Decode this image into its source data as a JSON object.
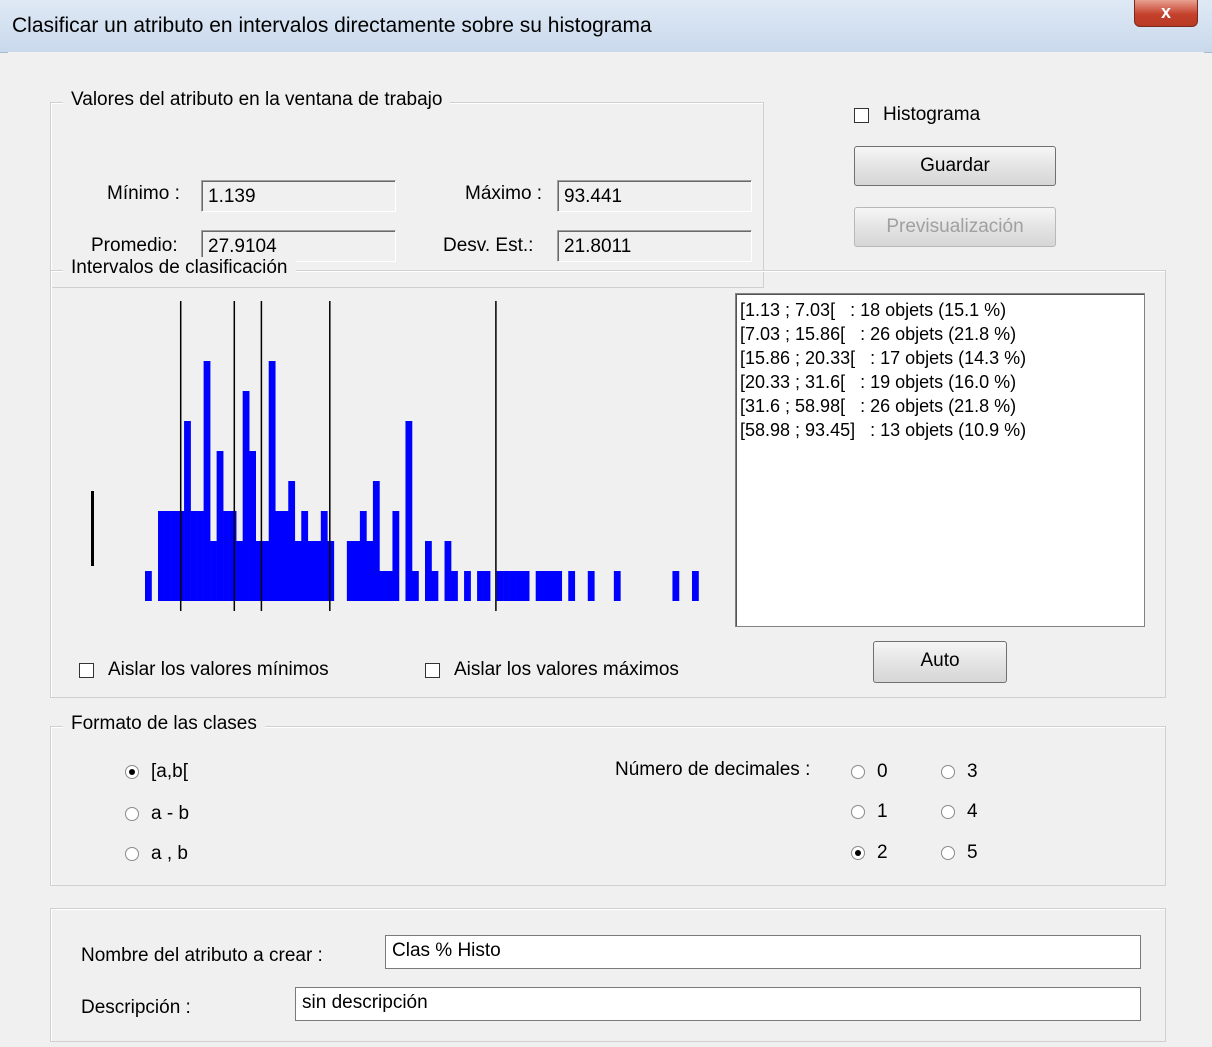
{
  "window": {
    "title": "Clasificar un atributo en intervalos directamente sobre su histograma",
    "close_label": "x"
  },
  "values_group": {
    "legend": "Valores del atributo en la ventana de trabajo",
    "min_label": "Mínimo :",
    "min_value": "1.139",
    "max_label": "Máximo :",
    "max_value": "93.441",
    "avg_label": "Promedio:",
    "avg_value": "27.9104",
    "std_label": "Desv. Est.:",
    "std_value": "21.8011"
  },
  "actions": {
    "histogram_label": "Histograma",
    "histogram_checked": false,
    "save_label": "Guardar",
    "preview_label": "Previsualización"
  },
  "intervals_group": {
    "legend": "Intervalos de clasificación",
    "list": [
      "[1.13 ; 7.03[   : 18 objets (15.1 %)",
      "[7.03 ; 15.86[   : 26 objets (21.8 %)",
      "[15.86 ; 20.33[   : 17 objets (14.3 %)",
      "[20.33 ; 31.6[   : 19 objets (16.0 %)",
      "[31.6 ; 58.98[   : 26 objets (21.8 %)",
      "[58.98 ; 93.45]   : 13 objets (10.9 %)"
    ],
    "isolate_min_label": "Aislar los valores mínimos",
    "isolate_max_label": "Aislar los valores máximos",
    "auto_label": "Auto",
    "bar_color": "#0000ff"
  },
  "chart_data": {
    "type": "bar",
    "x_range": [
      1.139,
      93.441
    ],
    "values": [
      1,
      0,
      3,
      3,
      3,
      3,
      6,
      3,
      3,
      8,
      2,
      5,
      3,
      3,
      2,
      7,
      5,
      2,
      2,
      8,
      3,
      3,
      4,
      2,
      3,
      2,
      2,
      3,
      2,
      0,
      0,
      2,
      2,
      3,
      2,
      4,
      1,
      1,
      3,
      0,
      6,
      1,
      0,
      2,
      1,
      0,
      2,
      1,
      0,
      1,
      0,
      1,
      1,
      0,
      1,
      1,
      1,
      1,
      1,
      0,
      1,
      1,
      1,
      1,
      0,
      1,
      0,
      0,
      1,
      0,
      0,
      0,
      1,
      0,
      0,
      0,
      0,
      0,
      0,
      0,
      0,
      1,
      0,
      0,
      1,
      0
    ],
    "breaks": [
      7.03,
      15.86,
      20.33,
      31.6,
      58.98
    ]
  },
  "format_group": {
    "legend": "Formato de las clases",
    "formats": [
      {
        "label": "[a,b[",
        "checked": true
      },
      {
        "label": "a - b",
        "checked": false
      },
      {
        "label": "a , b",
        "checked": false
      }
    ],
    "decimals_label": "Número de decimales :",
    "decimals": [
      {
        "label": "0",
        "checked": false
      },
      {
        "label": "1",
        "checked": false
      },
      {
        "label": "2",
        "checked": true
      },
      {
        "label": "3",
        "checked": false
      },
      {
        "label": "4",
        "checked": false
      },
      {
        "label": "5",
        "checked": false
      }
    ]
  },
  "name_group": {
    "name_label": "Nombre del atributo a crear :",
    "name_value": "Clas % Histo",
    "desc_label": "Descripción :",
    "desc_value": "sin descripción"
  }
}
